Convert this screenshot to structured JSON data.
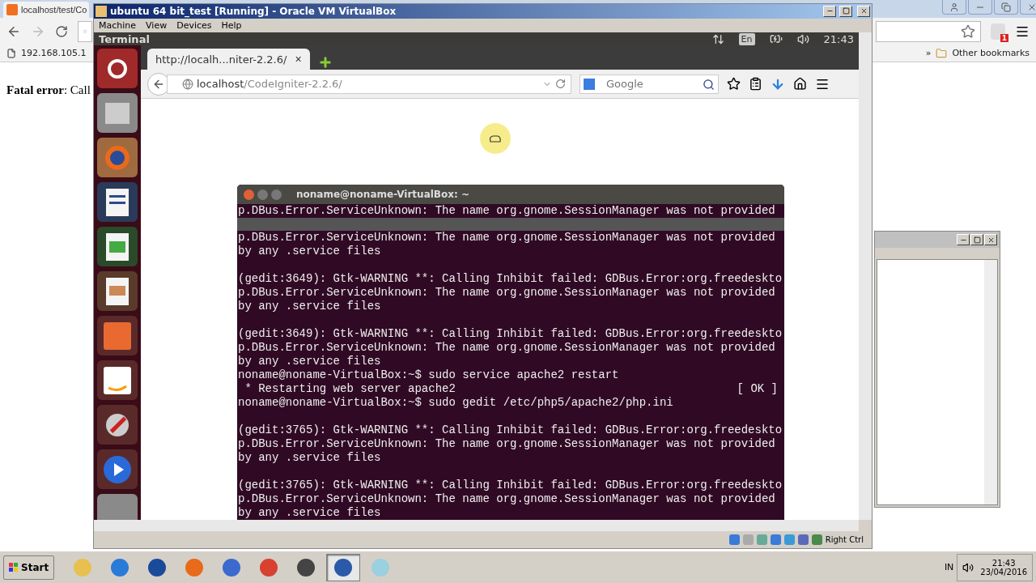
{
  "host_browser": {
    "tab_title": "localhost/test/Co",
    "bookmarks": [
      "192.168.105.1"
    ],
    "bookmarks_overflow": "»",
    "other_bookmarks": "Other bookmarks",
    "extension_badge": "1",
    "content": "**Fatal error**: Call"
  },
  "vbox": {
    "title": "ubuntu 64 bit_test [Running] - Oracle VM VirtualBox",
    "menu": [
      "Machine",
      "View",
      "Devices",
      "Help"
    ],
    "host_key": "Right Ctrl"
  },
  "ubuntu_panel": {
    "app_title": "Terminal",
    "keyboard": "En",
    "time": "21:43"
  },
  "firefox": {
    "tab_title": "http://localh...niter-2.2.6/",
    "tab_close": "×",
    "url_host": "localhost",
    "url_path": "/CodeIgniter-2.2.6/",
    "search_placeholder": "Google"
  },
  "terminal": {
    "title": "noname@noname-VirtualBox: ~",
    "top_line": "p.DBus.Error.ServiceUnknown: The name org.gnome.SessionManager was not provided",
    "blocks": [
      [
        {
          "text": "p.DBus.Error.ServiceUnknown: The name org.gnome.SessionManager was not provided"
        },
        {
          "text": "by any .service files"
        }
      ],
      [
        {
          "text": "(gedit:3649): Gtk-WARNING **: Calling Inhibit failed: GDBus.Error:org.freedeskto"
        },
        {
          "text": "p.DBus.Error.ServiceUnknown: The name org.gnome.SessionManager was not provided"
        },
        {
          "text": "by any .service files"
        }
      ],
      [
        {
          "text": "(gedit:3649): Gtk-WARNING **: Calling Inhibit failed: GDBus.Error:org.freedeskto"
        },
        {
          "text": "p.DBus.Error.ServiceUnknown: The name org.gnome.SessionManager was not provided"
        },
        {
          "text": "by any .service files"
        },
        {
          "text": "noname@noname-VirtualBox:~$ sudo service apache2 restart"
        },
        {
          "text": " * Restarting web server apache2",
          "status": "[ OK ]"
        },
        {
          "text": "noname@noname-VirtualBox:~$ sudo gedit /etc/php5/apache2/php.ini"
        }
      ],
      [
        {
          "text": "(gedit:3765): Gtk-WARNING **: Calling Inhibit failed: GDBus.Error:org.freedeskto"
        },
        {
          "text": "p.DBus.Error.ServiceUnknown: The name org.gnome.SessionManager was not provided"
        },
        {
          "text": "by any .service files"
        }
      ],
      [
        {
          "text": "(gedit:3765): Gtk-WARNING **: Calling Inhibit failed: GDBus.Error:org.freedeskto"
        },
        {
          "text": "p.DBus.Error.ServiceUnknown: The name org.gnome.SessionManager was not provided"
        },
        {
          "text": "by any .service files"
        }
      ]
    ]
  },
  "taskbar": {
    "start": "Start",
    "apps": [
      {
        "selected": false
      },
      {
        "selected": false
      },
      {
        "selected": false
      },
      {
        "selected": false
      },
      {
        "selected": false
      },
      {
        "selected": false
      },
      {
        "selected": false
      },
      {
        "selected": true
      },
      {
        "selected": false
      }
    ],
    "language": "IN",
    "time": "21:43",
    "date": "23/04/2016"
  }
}
